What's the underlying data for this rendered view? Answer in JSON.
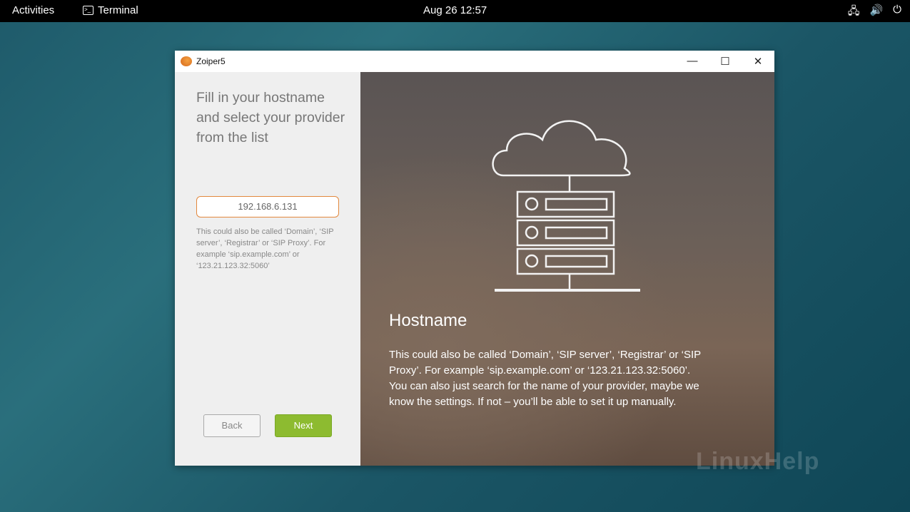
{
  "topbar": {
    "activities": "Activities",
    "app": "Terminal",
    "clock": "Aug 26  12:57",
    "icons": [
      "network-icon",
      "volume-icon",
      "power-icon"
    ]
  },
  "window": {
    "title": "Zoiper5",
    "controls": [
      "minimize",
      "maximize",
      "close"
    ]
  },
  "left": {
    "heading": " Fill in your hostname and select your provider from the list",
    "hostname_value": "192.168.6.131",
    "hint": "This could also be called ‘Domain’, ‘SIP server’, ‘Registrar’ or ‘SIP Proxy’. For example ‘sip.example.com’ or ‘123.21.123.32:5060’",
    "back": "Back",
    "next": "Next"
  },
  "right": {
    "title": "Hostname",
    "body1": " This could also be called ‘Domain’, ‘SIP server’, ‘Registrar’ or ‘SIP Proxy’. For example ‘sip.example.com’ or ‘123.21.123.32:5060’.",
    "body2": "You can also just search for the name of your provider, maybe we know the settings. If not – you’ll be able to set it up manually."
  },
  "watermark": "LinuxHelp",
  "colors": {
    "accent_green": "#8dbb30",
    "input_border": "#e2883e"
  }
}
